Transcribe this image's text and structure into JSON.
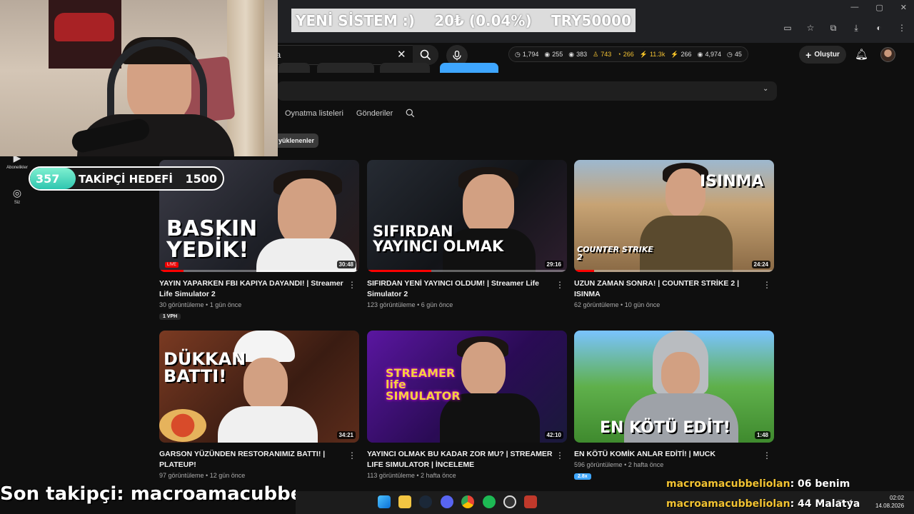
{
  "window": {
    "controls": [
      "—",
      "▢",
      "✕"
    ]
  },
  "donation": {
    "title": "YENİ SİSTEM :)",
    "amount": "20₺ (0.04%)",
    "goal": "TRY50000"
  },
  "search": {
    "value": "a"
  },
  "stats": [
    {
      "icon": "clock-icon",
      "glyph": "◷",
      "value": "1,794",
      "gold": false
    },
    {
      "icon": "eye-icon",
      "glyph": "◉",
      "value": "255",
      "gold": false
    },
    {
      "icon": "eye-icon",
      "glyph": "◉",
      "value": "383",
      "gold": false
    },
    {
      "icon": "person-icon",
      "glyph": "♙",
      "value": "743",
      "gold": true
    },
    {
      "icon": "coin-icon",
      "glyph": "◔",
      "value": "266",
      "gold": true
    },
    {
      "icon": "bolt-icon",
      "glyph": "⚡",
      "value": "11.3k",
      "gold": true
    },
    {
      "icon": "bolt-icon",
      "glyph": "⚡",
      "value": "266",
      "gold": false
    },
    {
      "icon": "eye-icon",
      "glyph": "◉",
      "value": "4,974",
      "gold": false
    },
    {
      "icon": "clock-icon",
      "glyph": "◷",
      "value": "45",
      "gold": false
    }
  ],
  "header": {
    "create_label": "Oluştur"
  },
  "channel": {
    "tabs": [
      "Oynatma listeleri",
      "Gönderiler"
    ],
    "filter_chip": "yüklenenler"
  },
  "sidebar": {
    "subscriptions": "Abonelikler",
    "you": "Siz"
  },
  "goal": {
    "start": "357",
    "label": "TAKİPÇİ HEDEFİ",
    "end": "1500",
    "progress": 0.238
  },
  "videos": [
    {
      "thumb_text": "BASKIN YEDİK!",
      "duration": "30:48",
      "title": "YAYIN YAPARKEN FBI KAPIYA DAYANDI! | Streamer Life Simulator 2",
      "views": "30 görüntüleme",
      "age": "1 gün önce",
      "badge": "1 VPH",
      "live_tag": "LIVE",
      "progress": 0.12
    },
    {
      "thumb_text": "SIFIRDAN YAYINCI OLMAK",
      "duration": "29:16",
      "title": "SIFIRDAN YENİ YAYINCI OLDUM! | Streamer Life Simulator 2",
      "views": "123 görüntüleme",
      "age": "6 gün önce",
      "progress": 0.32
    },
    {
      "thumb_text": "ISINMA",
      "duration": "24:24",
      "title": "UZUN ZAMAN SONRA! | COUNTER STRİKE 2 | ISINMA",
      "views": "62 görüntüleme",
      "age": "10 gün önce",
      "logo_text": "COUNTER STRIKE 2",
      "progress": 0.1
    },
    {
      "thumb_text": "DÜKKAN BATTI!",
      "duration": "34:21",
      "title": "GARSON YÜZÜNDEN RESTORANIMIZ BATTI! | PLATEUP!",
      "views": "97 görüntüleme",
      "age": "12 gün önce",
      "progress": 0
    },
    {
      "thumb_text": "STREAMER life SIMULATOR",
      "duration": "42:10",
      "title": "YAYINCI OLMAK BU KADAR ZOR MU? | STREAMER LIFE SIMULATOR | İNCELEME",
      "views": "113 görüntüleme",
      "age": "2 hafta önce",
      "progress": 0
    },
    {
      "thumb_text": "EN KÖTÜ EDİT!",
      "duration": "1:48",
      "title": "EN KÖTÜ KOMİK ANLAR EDİTİ! | MUCK",
      "views": "596 görüntüleme",
      "age": "2 hafta önce",
      "badge": "2.8x",
      "progress": 0
    }
  ],
  "overlay": {
    "last_follower": "Son takipçi: macroamacubbeliolan",
    "chat": [
      {
        "user": "macroamacubbeliolan",
        "msg": ": 06 benim"
      },
      {
        "user": "macroamacubbeliolan",
        "msg": ": 44 Malatya"
      }
    ]
  },
  "taskbar": {
    "time": "02:02",
    "date": "14.08.2026"
  }
}
